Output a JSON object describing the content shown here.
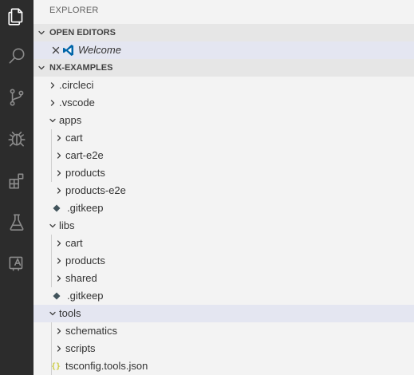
{
  "sidebar": {
    "title": "EXPLORER",
    "open_editors": {
      "header": "OPEN EDITORS",
      "items": [
        {
          "label": "Welcome"
        }
      ]
    },
    "workspace": {
      "header": "NX-EXAMPLES",
      "tree": [
        {
          "label": ".circleci"
        },
        {
          "label": ".vscode"
        },
        {
          "label": "apps"
        },
        {
          "label": "cart"
        },
        {
          "label": "cart-e2e"
        },
        {
          "label": "products"
        },
        {
          "label": "products-e2e"
        },
        {
          "label": ".gitkeep"
        },
        {
          "label": "libs"
        },
        {
          "label": "cart"
        },
        {
          "label": "products"
        },
        {
          "label": "shared"
        },
        {
          "label": ".gitkeep"
        },
        {
          "label": "tools"
        },
        {
          "label": "schematics"
        },
        {
          "label": "scripts"
        },
        {
          "label": "tsconfig.tools.json"
        }
      ]
    }
  },
  "activity_bar": {
    "icons": [
      "files-icon",
      "search-icon",
      "source-control-icon",
      "debug-icon",
      "extensions-icon",
      "testing-icon",
      "remote-icon"
    ]
  },
  "colors": {
    "activity_bar_bg": "#2c2c2c",
    "sidebar_bg": "#f3f3f3",
    "section_header_bg": "#e6e6e6",
    "selection_bg": "#e4e6f1",
    "vscode_blue": "#0065a9",
    "git_icon": "#41535b",
    "json_icon": "#cbcb41"
  }
}
